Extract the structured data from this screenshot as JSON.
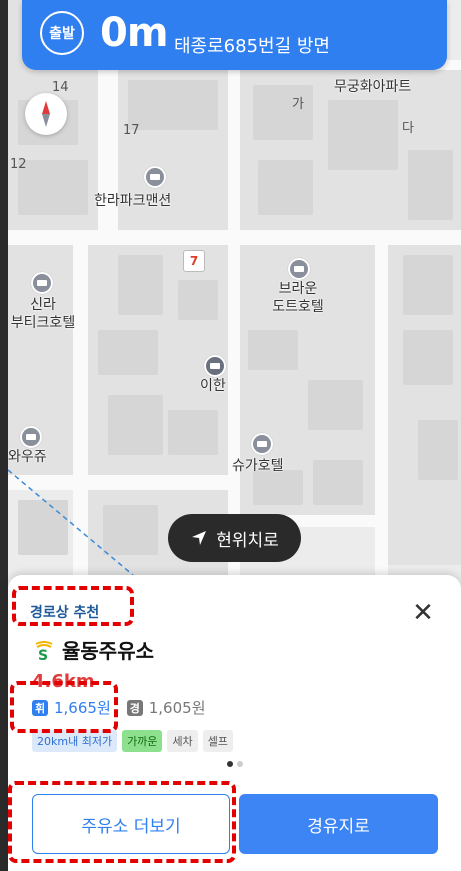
{
  "banner": {
    "badge": "출발",
    "distance": "0m",
    "road": "태종로685번길 방면",
    "color": "#2f7ff0"
  },
  "map": {
    "pois": [
      {
        "name": "무궁화아파트",
        "icon": "none"
      },
      {
        "name": "한라파크맨션",
        "icon": "building-icon"
      },
      {
        "name": "신라\n부티크호텔",
        "icon": "hotel-icon"
      },
      {
        "name": "브라운\n도트호텔",
        "icon": "hotel-icon"
      },
      {
        "name": "이한",
        "icon": "place-icon"
      },
      {
        "name": "와우쥬",
        "icon": "cafe-icon"
      },
      {
        "name": "슈가호텔",
        "icon": "hotel-icon"
      }
    ],
    "lot_numbers": [
      "14",
      "17",
      "12",
      "가",
      "다"
    ],
    "locate_button": "현위치로"
  },
  "sheet": {
    "recommend_label": "경로상 추천",
    "station_name": "율동주유소",
    "distance": "4.6km",
    "prices": [
      {
        "type": "휘",
        "price": "1,665원",
        "color": "#2f7ff0"
      },
      {
        "type": "경",
        "price": "1,605원",
        "color": "#777777"
      }
    ],
    "tags": [
      {
        "label": "20km내 최저가",
        "bg": "#dce9fb",
        "fg": "#2f6fd0"
      },
      {
        "label": "가까운",
        "bg": "#8de08d",
        "fg": "#136d13"
      },
      {
        "label": "세차",
        "bg": "#eeeeee",
        "fg": "#555555"
      },
      {
        "label": "셀프",
        "bg": "#eeeeee",
        "fg": "#555555"
      }
    ],
    "more_button": "주유소 더보기",
    "via_button": "경유지로"
  }
}
